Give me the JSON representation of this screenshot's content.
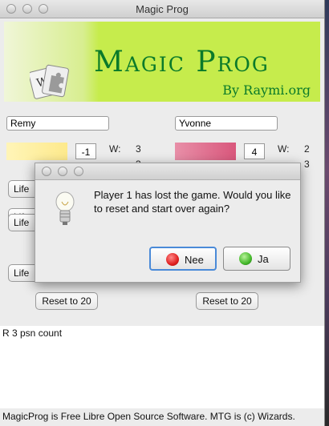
{
  "window": {
    "title": "Magic Prog"
  },
  "banner": {
    "title": "Magic Prog",
    "byline": "By Raymi.org"
  },
  "player1": {
    "name": "Remy",
    "life": "-1",
    "w_label": "W:",
    "wins": "3",
    "partial": "3",
    "buttons": [
      "Life",
      "Life",
      "Life",
      "Life"
    ],
    "reset_label": "Reset to 20",
    "color": "#fde98c"
  },
  "player2": {
    "name": "Yvonne",
    "life": "4",
    "w_label": "W:",
    "wins": "2",
    "partial": "3",
    "reset_label": "Reset to 20",
    "color": "#d9577c"
  },
  "log": {
    "text": "R 3 psn count"
  },
  "footer": {
    "text": "MagicProg is Free Libre Open Source Software. MTG is (c) Wizards."
  },
  "dialog": {
    "message": "Player 1 has lost the game. Would you like to reset and start over again?",
    "no_label": "Nee",
    "no_color": "#e02020",
    "yes_label": "Ja",
    "yes_color": "#44b82a"
  },
  "icons": [
    "close-icon",
    "minimize-icon",
    "zoom-icon",
    "puzzle-card-icon",
    "lightbulb-icon"
  ]
}
